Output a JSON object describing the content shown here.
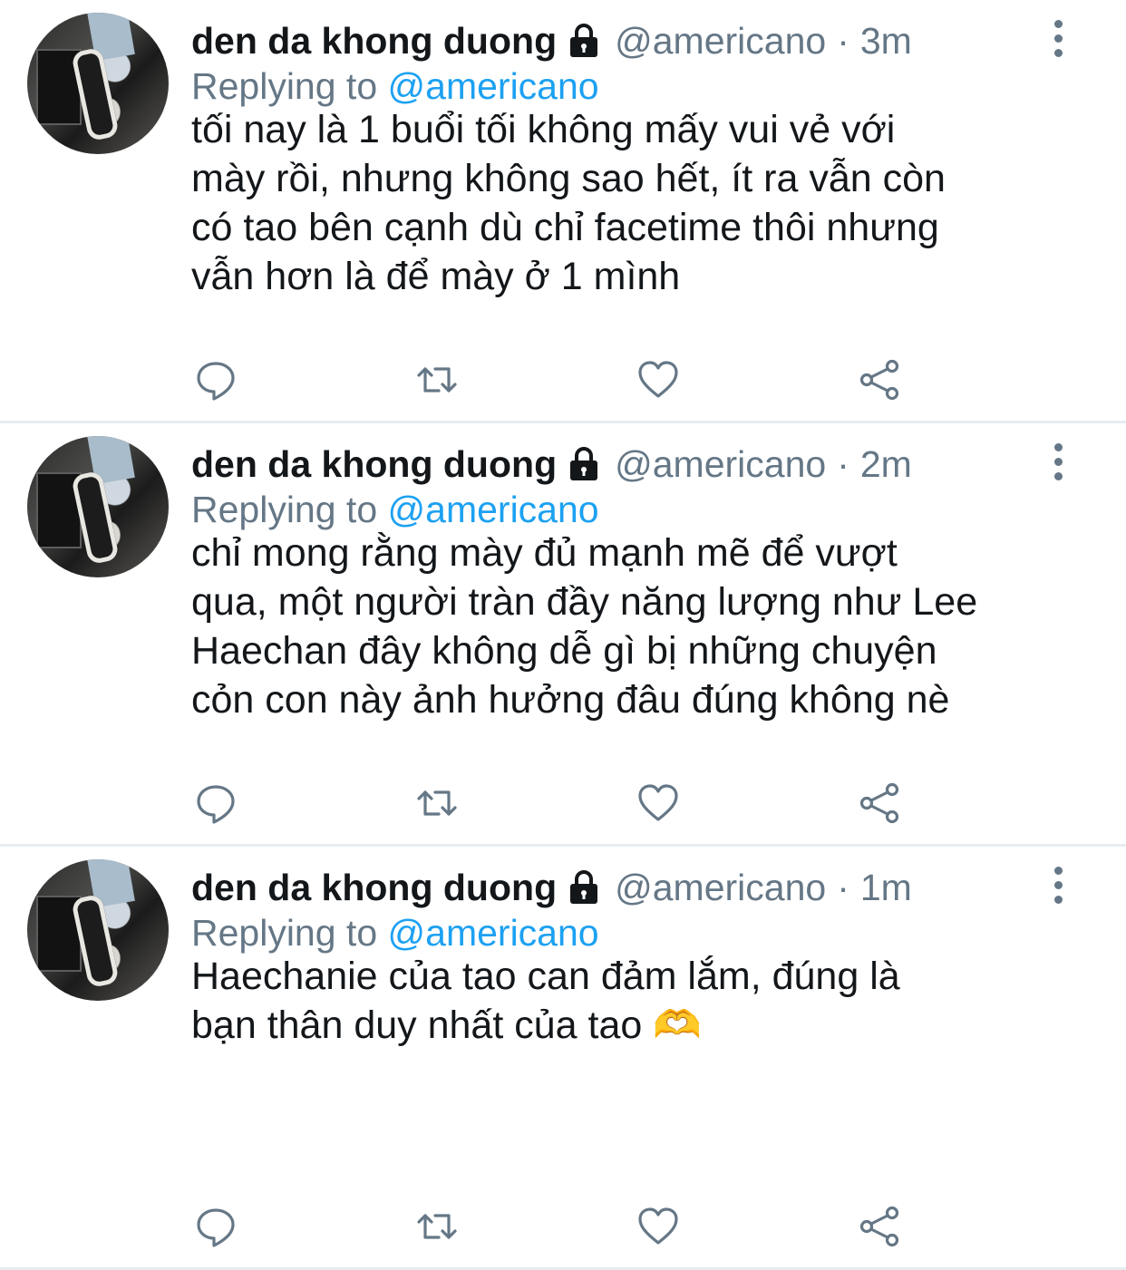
{
  "tweets": [
    {
      "name": "den da khong duong",
      "handle": "@americano",
      "dot": "·",
      "time": "3m",
      "replying_prefix": "Replying to",
      "replying_to": "@americano",
      "lines": [
        "tối nay là 1 buổi tối không mấy vui vẻ với",
        "mày rồi, nhưng không sao hết, ít ra vẫn còn",
        "có tao bên cạnh dù chỉ facetime thôi nhưng",
        "vẫn hơn là để mày ở 1 mình"
      ]
    },
    {
      "name": "den da khong duong",
      "handle": "@americano",
      "dot": "·",
      "time": "2m",
      "replying_prefix": "Replying to",
      "replying_to": "@americano",
      "lines": [
        "chỉ mong rằng mày đủ mạnh mẽ để vượt",
        "qua, một người tràn đầy năng lượng như Lee",
        "Haechan đây không dễ gì bị những chuyện",
        "cỏn con này ảnh hưởng đâu đúng không nè"
      ]
    },
    {
      "name": "den da khong duong",
      "handle": "@americano",
      "dot": "·",
      "time": "1m",
      "replying_prefix": "Replying to",
      "replying_to": "@americano",
      "lines": [
        "Haechanie của tao can đảm lắm, đúng là",
        "bạn thân duy nhất của tao 🫶"
      ]
    }
  ],
  "icons": {
    "lock": "lock-icon",
    "more": "more-vertical-icon",
    "reply": "reply-icon",
    "retweet": "retweet-icon",
    "like": "heart-icon",
    "share": "share-icon"
  },
  "colors": {
    "text": "#14171a",
    "secondary": "#657786",
    "link": "#1da1f2",
    "divider": "#e6ecf0"
  }
}
